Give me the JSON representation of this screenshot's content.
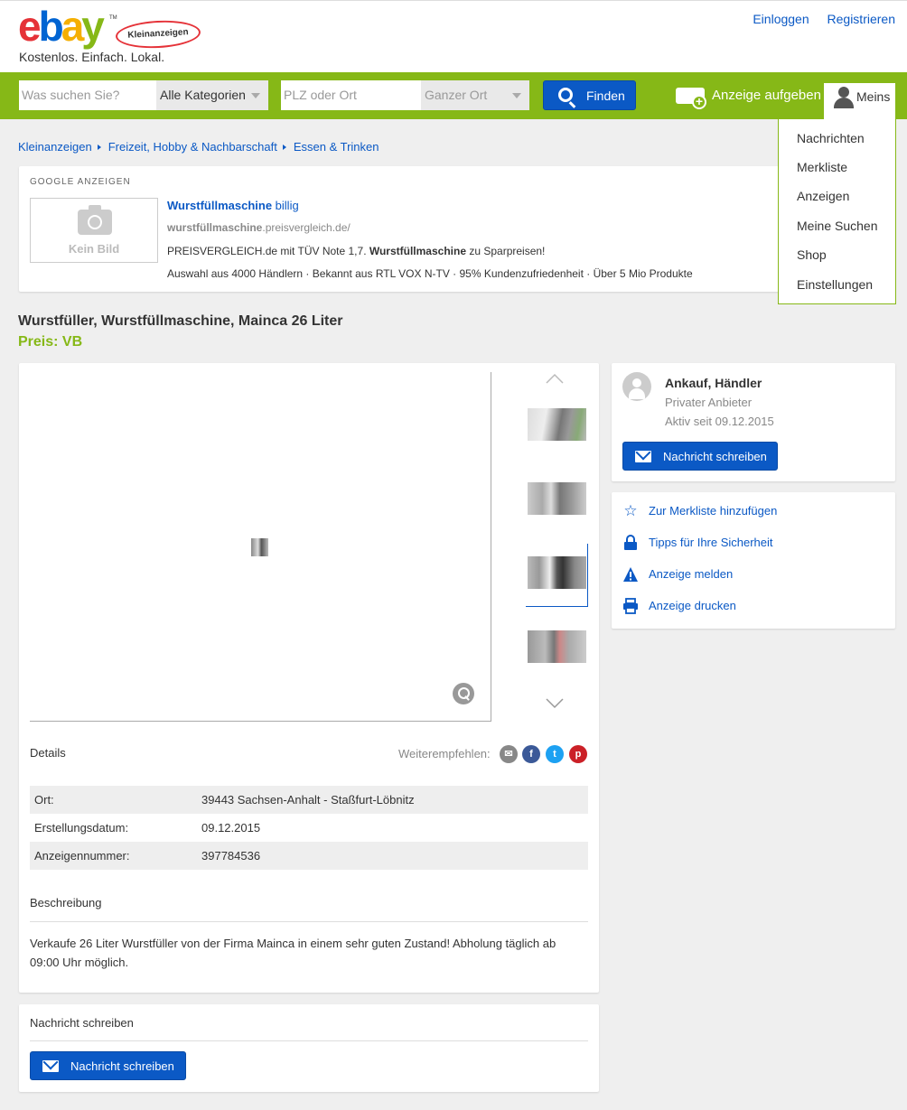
{
  "header": {
    "logo_badge": "Kleinanzeigen",
    "logo_tm": "TM",
    "tagline": "Kostenlos. Einfach. Lokal.",
    "login": "Einloggen",
    "register": "Registrieren"
  },
  "search": {
    "query_placeholder": "Was suchen Sie?",
    "category": "Alle Kategorien",
    "location_placeholder": "PLZ oder Ort",
    "radius": "Ganzer Ort",
    "find_label": "Finden",
    "post_ad": "Anzeige aufgeben",
    "meins": "Meins"
  },
  "meins_menu": [
    "Nachrichten",
    "Merkliste",
    "Anzeigen",
    "Meine Suchen",
    "Shop",
    "Einstellungen"
  ],
  "breadcrumb": [
    "Kleinanzeigen",
    "Freizeit, Hobby & Nachbarschaft",
    "Essen & Trinken"
  ],
  "google_ad": {
    "label": "GOOGLE ANZEIGEN",
    "no_image": "Kein Bild",
    "title_bold": "Wurstfüllmaschine",
    "title_rest": " billig",
    "url_bold": "wurstfüllmaschine",
    "url_rest": ".preisvergleich.de/",
    "line1_a": "PREISVERGLEICH.de mit TÜV Note 1,7. ",
    "line1_bold": "Wurstfüllmaschine",
    "line1_b": " zu Sparpreisen!",
    "line2": "Auswahl aus 4000 Händlern · Bekannt aus RTL VOX N-TV · 95% Kundenzufriedenheit · Über 5 Mio Produkte"
  },
  "listing": {
    "title": "Wurstfüller, Wurstfüllmaschine, Mainca 26 Liter",
    "price": "Preis: VB"
  },
  "details": {
    "heading": "Details",
    "share_label": "Weiterempfehlen:",
    "share_icons": [
      "email-icon",
      "facebook-icon",
      "twitter-icon",
      "pinterest-icon"
    ],
    "rows": [
      {
        "key": "Ort:",
        "value": "39443 Sachsen-Anhalt - Staßfurt-Löbnitz"
      },
      {
        "key": "Erstellungsdatum:",
        "value": "09.12.2015"
      },
      {
        "key": "Anzeigennummer:",
        "value": "397784536"
      }
    ],
    "description_heading": "Beschreibung",
    "description": "Verkaufe 26 Liter Wurstfüller von der Firma Mainca in einem sehr guten Zustand! Abholung täglich ab 09:00 Uhr möglich."
  },
  "message_section": {
    "heading": "Nachricht schreiben",
    "button": "Nachricht schreiben"
  },
  "seller": {
    "name": "Ankauf, Händler",
    "type": "Privater Anbieter",
    "since": "Aktiv seit 09.12.2015",
    "button": "Nachricht schreiben"
  },
  "actions": [
    {
      "icon": "star-icon",
      "label": "Zur Merkliste hinzufügen"
    },
    {
      "icon": "lock-icon",
      "label": "Tipps für Ihre Sicherheit"
    },
    {
      "icon": "warning-icon",
      "label": "Anzeige melden"
    },
    {
      "icon": "printer-icon",
      "label": "Anzeige drucken"
    }
  ],
  "colors": {
    "brand_green": "#86b817",
    "link_blue": "#0b59c5",
    "button_blue": "#0b59c5"
  }
}
